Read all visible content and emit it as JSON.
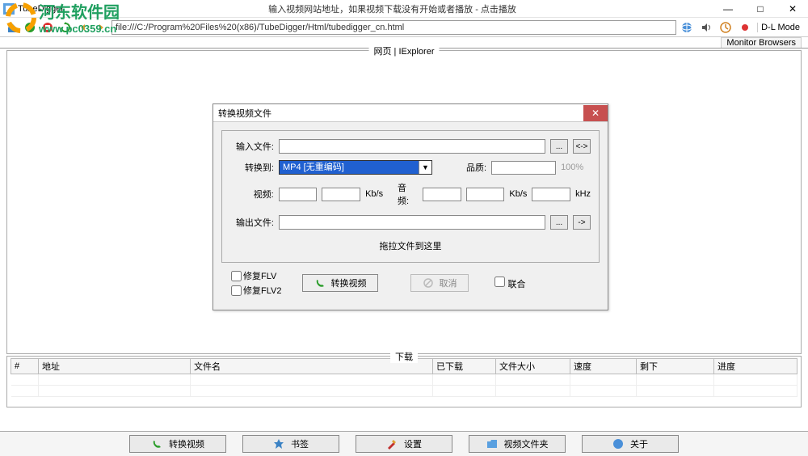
{
  "window": {
    "title": "TubeDigger",
    "hint": "输入视频网站地址，如果视频下载没有开始或者播放 - 点击播放",
    "min": "—",
    "max": "□",
    "close": "✕"
  },
  "watermark": {
    "line1": "河东软件园",
    "line2": "www.pc0359.cn"
  },
  "toolbar": {
    "url": "file:///C:/Program%20Files%20(x86)/TubeDigger/Html/tubedigger_cn.html",
    "icons": {
      "home": "home-icon",
      "go": "go-icon",
      "stop": "stop-icon",
      "refresh": "refresh-icon",
      "back": "back-icon",
      "fwd": "forward-icon"
    },
    "right": {
      "globe": "globe-icon",
      "sound": "sound-icon",
      "clock": "clock-icon",
      "mode": "D-L Mode"
    }
  },
  "monitor": "Monitor Browsers",
  "panels": {
    "web_legend": "网页 | IExplorer",
    "dl_legend": "下载"
  },
  "dialog": {
    "title": "转换视频文件",
    "close": "✕",
    "labels": {
      "input": "输入文件:",
      "convert_to": "转换到:",
      "quality": "品质:",
      "quality_val": "100%",
      "video": "视频:",
      "audio": "音频:",
      "kbs": "Kb/s",
      "khz": "kHz",
      "output": "输出文件:",
      "dragmsg": "拖拉文件到这里"
    },
    "combo_selected": "MP4 [无重编码]",
    "browse": "...",
    "swap": "<->",
    "go": "->",
    "footer": {
      "fix_flv": "修复FLV",
      "fix_flv2": "修复FLV2",
      "convert": "转换视频",
      "cancel": "取消",
      "combine": "联合"
    }
  },
  "table": {
    "cols": {
      "num": "#",
      "url": "地址",
      "file": "文件名",
      "downloaded": "已下载",
      "size": "文件大小",
      "speed": "速度",
      "remain": "剩下",
      "progress": "进度"
    }
  },
  "bottom": {
    "convert": "转换视频",
    "bookmark": "书签",
    "settings": "设置",
    "folder": "视频文件夹",
    "about": "关于"
  }
}
